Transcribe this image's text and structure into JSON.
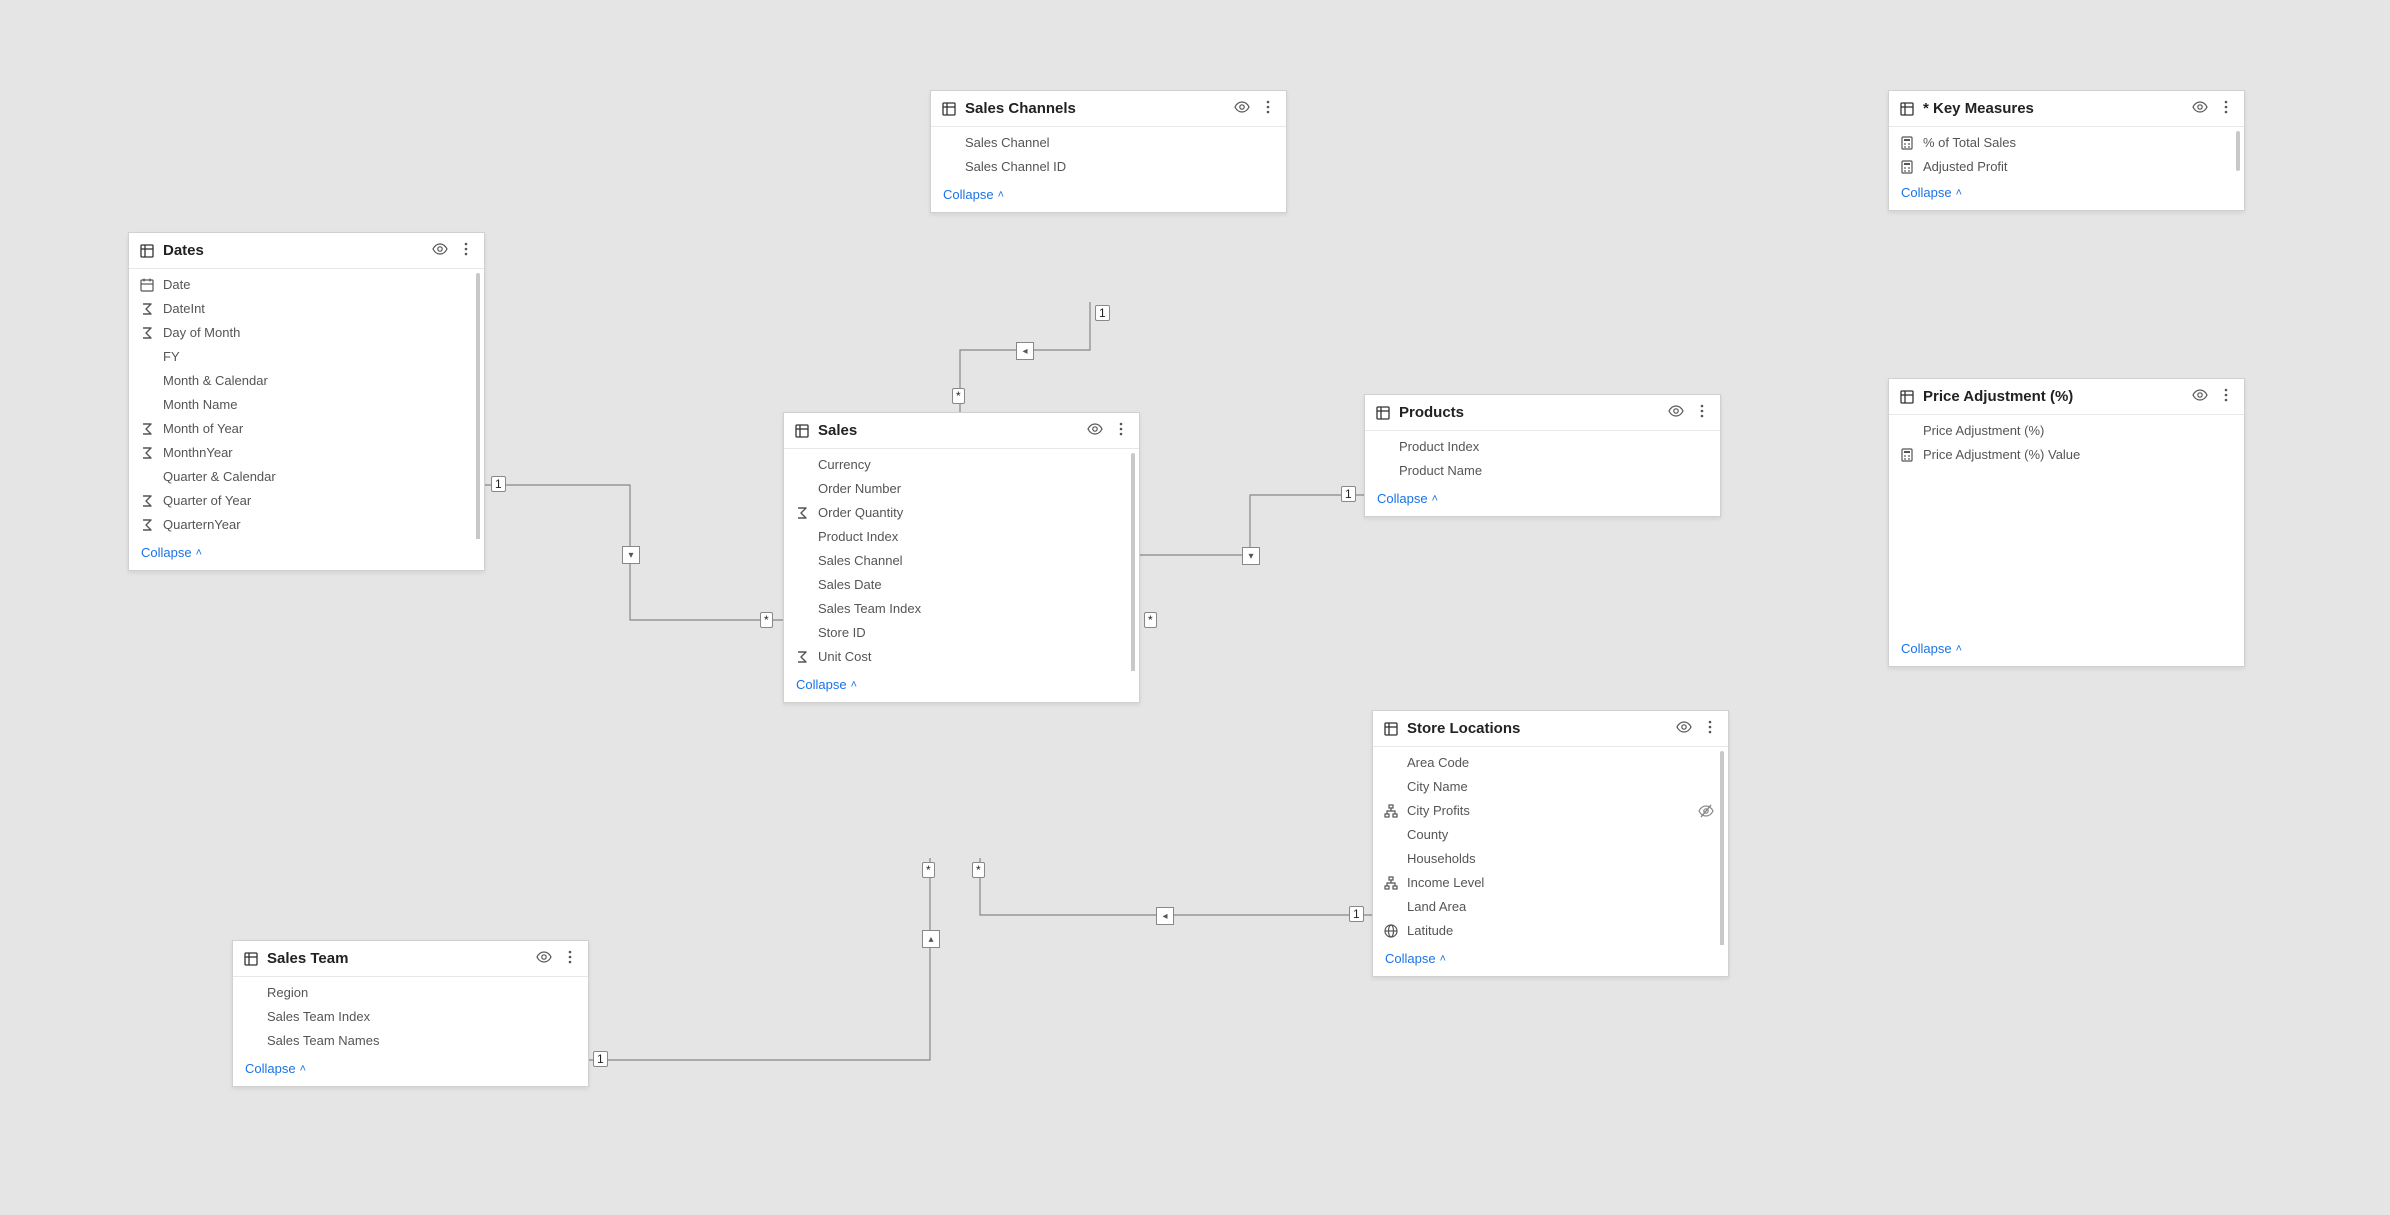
{
  "collapse_label": "Collapse",
  "tables": {
    "dates": {
      "title": "Dates",
      "fields": [
        {
          "icon": "calendar",
          "label": "Date"
        },
        {
          "icon": "sigma",
          "label": "DateInt"
        },
        {
          "icon": "sigma",
          "label": "Day of Month"
        },
        {
          "icon": "",
          "label": "FY"
        },
        {
          "icon": "",
          "label": "Month & Calendar"
        },
        {
          "icon": "",
          "label": "Month Name"
        },
        {
          "icon": "sigma",
          "label": "Month of Year"
        },
        {
          "icon": "sigma",
          "label": "MonthnYear"
        },
        {
          "icon": "",
          "label": "Quarter & Calendar"
        },
        {
          "icon": "sigma",
          "label": "Quarter of Year"
        },
        {
          "icon": "sigma",
          "label": "QuarternYear"
        }
      ]
    },
    "sales_channels": {
      "title": "Sales Channels",
      "fields": [
        {
          "icon": "",
          "label": "Sales Channel"
        },
        {
          "icon": "",
          "label": "Sales Channel ID"
        }
      ]
    },
    "sales": {
      "title": "Sales",
      "fields": [
        {
          "icon": "",
          "label": "Currency"
        },
        {
          "icon": "",
          "label": "Order Number"
        },
        {
          "icon": "sigma",
          "label": "Order Quantity"
        },
        {
          "icon": "",
          "label": "Product Index"
        },
        {
          "icon": "",
          "label": "Sales Channel"
        },
        {
          "icon": "",
          "label": "Sales Date"
        },
        {
          "icon": "",
          "label": "Sales Team Index"
        },
        {
          "icon": "",
          "label": "Store ID"
        },
        {
          "icon": "sigma",
          "label": "Unit Cost"
        }
      ]
    },
    "products": {
      "title": "Products",
      "fields": [
        {
          "icon": "",
          "label": "Product Index"
        },
        {
          "icon": "",
          "label": "Product Name"
        }
      ]
    },
    "store_locations": {
      "title": "Store Locations",
      "fields": [
        {
          "icon": "",
          "label": "Area Code"
        },
        {
          "icon": "",
          "label": "City Name"
        },
        {
          "icon": "hierarchy",
          "label": "City Profits",
          "right": "hidden"
        },
        {
          "icon": "",
          "label": "County"
        },
        {
          "icon": "",
          "label": "Households"
        },
        {
          "icon": "hierarchy",
          "label": "Income Level"
        },
        {
          "icon": "",
          "label": "Land Area"
        },
        {
          "icon": "globe",
          "label": "Latitude"
        }
      ]
    },
    "sales_team": {
      "title": "Sales Team",
      "fields": [
        {
          "icon": "",
          "label": "Region"
        },
        {
          "icon": "",
          "label": "Sales Team Index"
        },
        {
          "icon": "",
          "label": "Sales Team Names"
        }
      ]
    },
    "key_measures": {
      "title": "* Key Measures",
      "fields": [
        {
          "icon": "calc",
          "label": "% of Total Sales"
        },
        {
          "icon": "calc",
          "label": "Adjusted Profit"
        }
      ]
    },
    "price_adjustment": {
      "title": "Price Adjustment (%)",
      "fields": [
        {
          "icon": "",
          "label": "Price Adjustment (%)"
        },
        {
          "icon": "calc",
          "label": "Price Adjustment (%) Value"
        }
      ]
    }
  },
  "cardinality": {
    "one": "1",
    "many": "*"
  }
}
